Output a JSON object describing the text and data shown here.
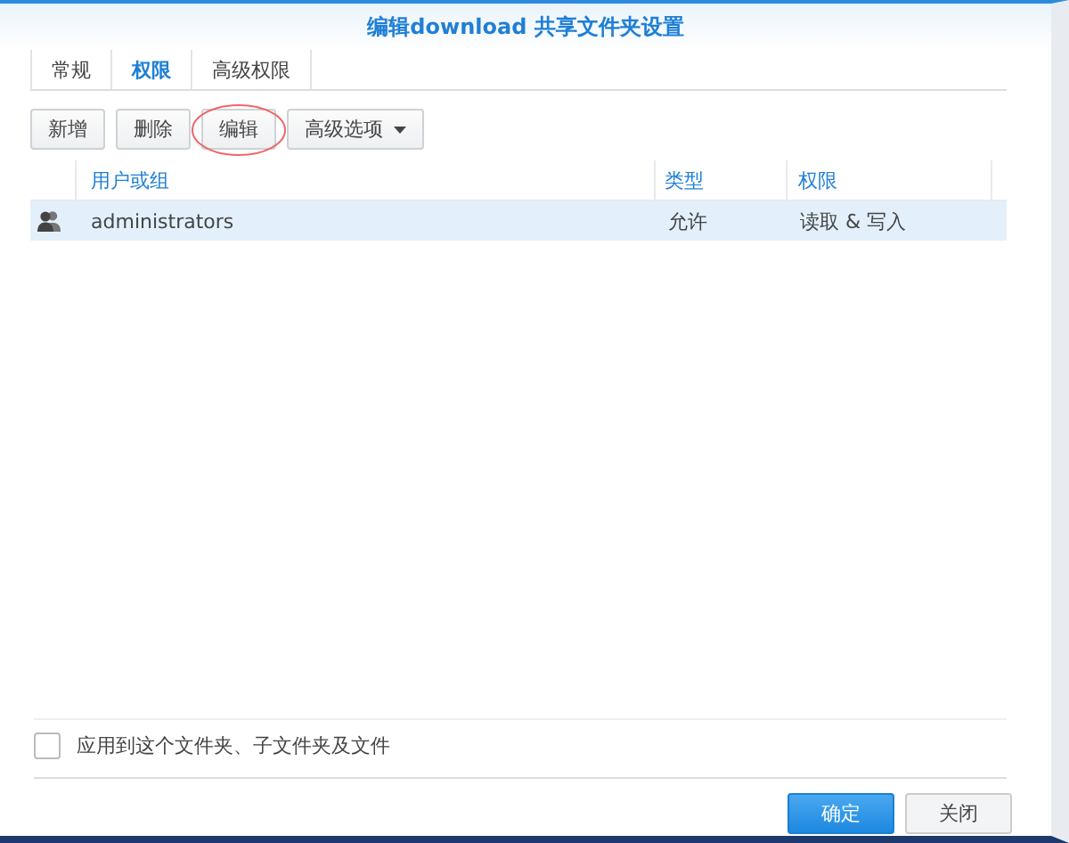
{
  "window": {
    "title": "编辑download 共享文件夹设置"
  },
  "tabs": [
    {
      "label": "常规",
      "selected": false
    },
    {
      "label": "权限",
      "selected": true
    },
    {
      "label": "高级权限",
      "selected": false
    }
  ],
  "toolbar": [
    {
      "label": "新增",
      "circled": false,
      "dropdown": false
    },
    {
      "label": "删除",
      "circled": false,
      "dropdown": false
    },
    {
      "label": "编辑",
      "circled": true,
      "dropdown": false
    },
    {
      "label": "高级选项",
      "circled": false,
      "dropdown": true
    }
  ],
  "table": {
    "columns": [
      "用户或组",
      "类型",
      "权限"
    ],
    "rows": [
      {
        "kind": "group",
        "name": "administrators",
        "type": "允许",
        "permission": "读取 & 写入",
        "selected": true
      }
    ]
  },
  "apply_checkbox": {
    "label": "应用到这个文件夹、子文件夹及文件",
    "checked": false
  },
  "buttons": [
    {
      "label": "确定",
      "kind": "primary"
    },
    {
      "label": "关闭",
      "kind": "secondary"
    }
  ]
}
